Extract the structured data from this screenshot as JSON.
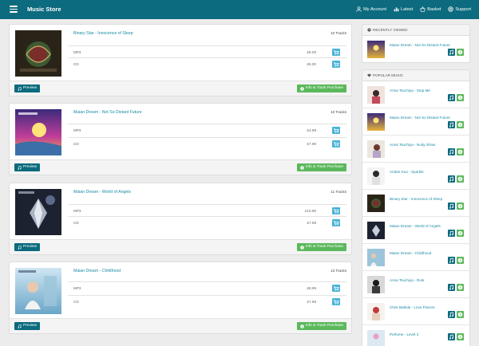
{
  "header": {
    "brand": "Music Store",
    "nav": [
      {
        "label": "My Account",
        "icon": "user-icon"
      },
      {
        "label": "Latest",
        "icon": "bars-icon"
      },
      {
        "label": "Basket",
        "icon": "basket-icon"
      },
      {
        "label": "Support",
        "icon": "life-ring-icon"
      }
    ]
  },
  "albums": [
    {
      "title": "Binary Star - Innocence of Sleep",
      "tracks": "10 Tracks",
      "formats": [
        {
          "format": "MP3",
          "price": "£5.00"
        },
        {
          "format": "CD",
          "price": "£5.00"
        }
      ],
      "preview_label": "Preview",
      "info_label": "Info & Track Purchase"
    },
    {
      "title": "Maian Dream - Not So Distant Future",
      "tracks": "10 Tracks",
      "formats": [
        {
          "format": "MP3",
          "price": "£4.99"
        },
        {
          "format": "CD",
          "price": "£7.99"
        }
      ],
      "preview_label": "Preview",
      "info_label": "Info & Track Purchase"
    },
    {
      "title": "Maian Dream - World of Angels",
      "tracks": "11 Tracks",
      "formats": [
        {
          "format": "MP3",
          "price": "£10.99"
        },
        {
          "format": "CD",
          "price": "£7.99"
        }
      ],
      "preview_label": "Preview",
      "info_label": "Info & Track Purchase"
    },
    {
      "title": "Maian Dream - Childhood",
      "tracks": "13 Tracks",
      "formats": [
        {
          "format": "MP3",
          "price": "£8.99"
        },
        {
          "format": "CD",
          "price": "£7.99"
        }
      ],
      "preview_label": "Preview",
      "info_label": "Info & Track Purchase"
    }
  ],
  "recently_viewed": {
    "heading": "RECENTLY VIEWED",
    "items": [
      {
        "name": "Maian Dream - Not So Distant Future"
      }
    ]
  },
  "popular": {
    "heading": "POPULAR MUSIC",
    "items": [
      {
        "name": "Anna Tsuchiya - Stop Me"
      },
      {
        "name": "Maian Dream - Not So Distant Future"
      },
      {
        "name": "Anna Tsuchiya - Nudy Show"
      },
      {
        "name": "Amber Kuo - Sparkle"
      },
      {
        "name": "Binary Star - Innocence of Sleep"
      },
      {
        "name": "Maian Dream - World of Angels"
      },
      {
        "name": "Maian Dream - Childhood"
      },
      {
        "name": "Anna Tsuchiya - Rule"
      },
      {
        "name": "Chris Babida - Love Flavors"
      },
      {
        "name": "Perfume - Level 3"
      }
    ]
  },
  "colors": {
    "primary": "#0c6b7e",
    "success": "#5cb85c",
    "info": "#4ab3d6",
    "link": "#1a8aa5"
  }
}
